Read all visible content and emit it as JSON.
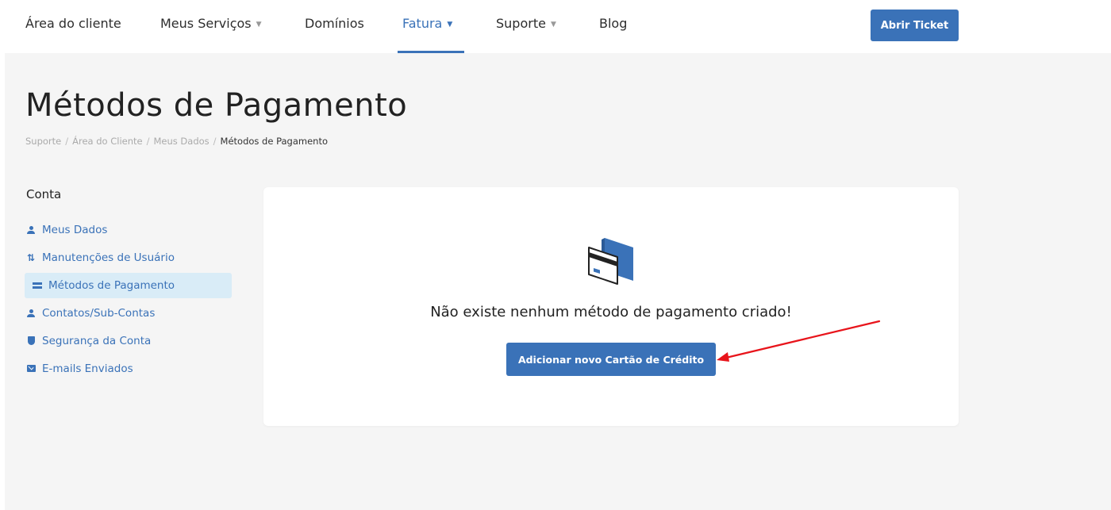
{
  "nav": {
    "items": [
      {
        "label": "Área do cliente",
        "dropdown": false,
        "active": false
      },
      {
        "label": "Meus Serviços",
        "dropdown": true,
        "active": false
      },
      {
        "label": "Domínios",
        "dropdown": false,
        "active": false
      },
      {
        "label": "Fatura",
        "dropdown": true,
        "active": true
      },
      {
        "label": "Suporte",
        "dropdown": true,
        "active": false
      },
      {
        "label": "Blog",
        "dropdown": false,
        "active": false
      }
    ],
    "ticket_button": "Abrir Ticket"
  },
  "page": {
    "title": "Métodos de Pagamento",
    "breadcrumb": [
      "Suporte",
      "Área do Cliente",
      "Meus Dados",
      "Métodos de Pagamento"
    ],
    "breadcrumb_separator": "/"
  },
  "sidebar": {
    "heading": "Conta",
    "items": [
      {
        "label": "Meus Dados",
        "icon": "user-icon"
      },
      {
        "label": "Manutenções de Usuário",
        "icon": "sort-arrows-icon",
        "glyph": "⇅"
      },
      {
        "label": "Métodos de Pagamento",
        "icon": "credit-card-icon",
        "selected": true
      },
      {
        "label": "Contatos/Sub-Contas",
        "icon": "user-icon"
      },
      {
        "label": "Segurança da Conta",
        "icon": "shield-icon"
      },
      {
        "label": "E-mails Enviados",
        "icon": "envelope-icon"
      }
    ]
  },
  "main": {
    "empty_message": "Não existe nenhum método de pagamento criado!",
    "add_card_button": "Adicionar novo Cartão de Crédito",
    "icon": "credit-cards-illustration-icon"
  },
  "colors": {
    "accent": "#3a72b8",
    "selected_bg": "#d9ecf7",
    "content_bg": "#f5f5f5",
    "annotation": "#e8141b"
  }
}
